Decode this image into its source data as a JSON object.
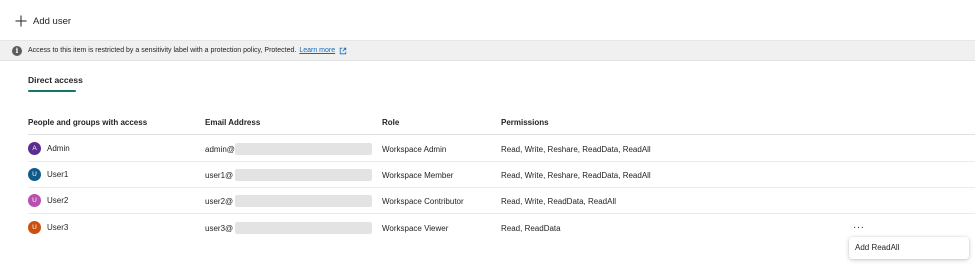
{
  "toolbar": {
    "add_user_label": "Add user"
  },
  "banner": {
    "message": "Access to this item is restricted by a sensitivity label with a protection policy, Protected.",
    "link_text": "Learn more",
    "icons": [
      "info-icon",
      "external-link-icon"
    ]
  },
  "tabs": [
    {
      "label": "Direct access",
      "active": true
    }
  ],
  "table": {
    "headers": [
      "People and groups with access",
      "Email Address",
      "Role",
      "Permissions"
    ],
    "rows": [
      {
        "initial": "A",
        "name": "Admin",
        "email_prefix": "admin@",
        "role": "Workspace Admin",
        "permissions": "Read, Write, Reshare, ReadData, ReadAll",
        "avatar_color": "#5b2d90"
      },
      {
        "initial": "U",
        "name": "User1",
        "email_prefix": "user1@",
        "role": "Workspace Member",
        "permissions": "Read, Write, Reshare, ReadData, ReadAll",
        "avatar_color": "#0e5a8a"
      },
      {
        "initial": "U",
        "name": "User2",
        "email_prefix": "user2@",
        "role": "Workspace Contributor",
        "permissions": "Read, Write, ReadData, ReadAll",
        "avatar_color": "#b84fb1"
      },
      {
        "initial": "U",
        "name": "User3",
        "email_prefix": "user3@",
        "role": "Workspace Viewer",
        "permissions": "Read, ReadData",
        "avatar_color": "#ca5010"
      }
    ]
  },
  "row_actions": {
    "more_label": "···"
  },
  "context_menu": {
    "items": [
      "Add ReadAll"
    ]
  },
  "colors": {
    "accent": "#117865",
    "link": "#0f6cbd"
  }
}
